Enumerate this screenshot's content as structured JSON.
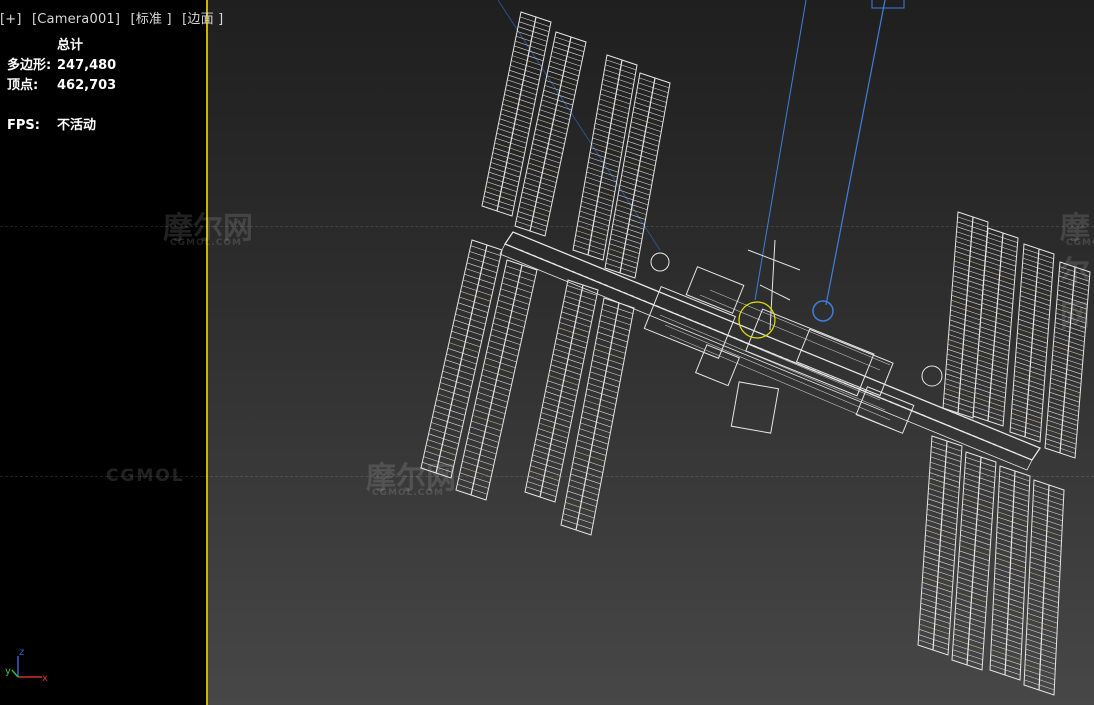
{
  "viewport": {
    "label_items": [
      "[+]",
      "[Camera001]",
      "[标准 ]",
      "[边面 ]"
    ]
  },
  "stats": {
    "header": "总计",
    "polys_label": "多边形:",
    "polys_value": "247,480",
    "verts_label": "顶点:",
    "verts_value": "462,703",
    "fps_label": "FPS:",
    "fps_value": "不活动"
  },
  "watermark": {
    "cn": "摩尔网",
    "en": "CGMOL.COM",
    "word": "CGMOL"
  },
  "axis": {
    "x": "x",
    "y": "y",
    "z": "z"
  },
  "colors": {
    "active_border": "#c9b400",
    "wireframe": "#e6e6e6",
    "camera_line": "#3d7fe0",
    "panel_tint": "#c9b58a"
  }
}
